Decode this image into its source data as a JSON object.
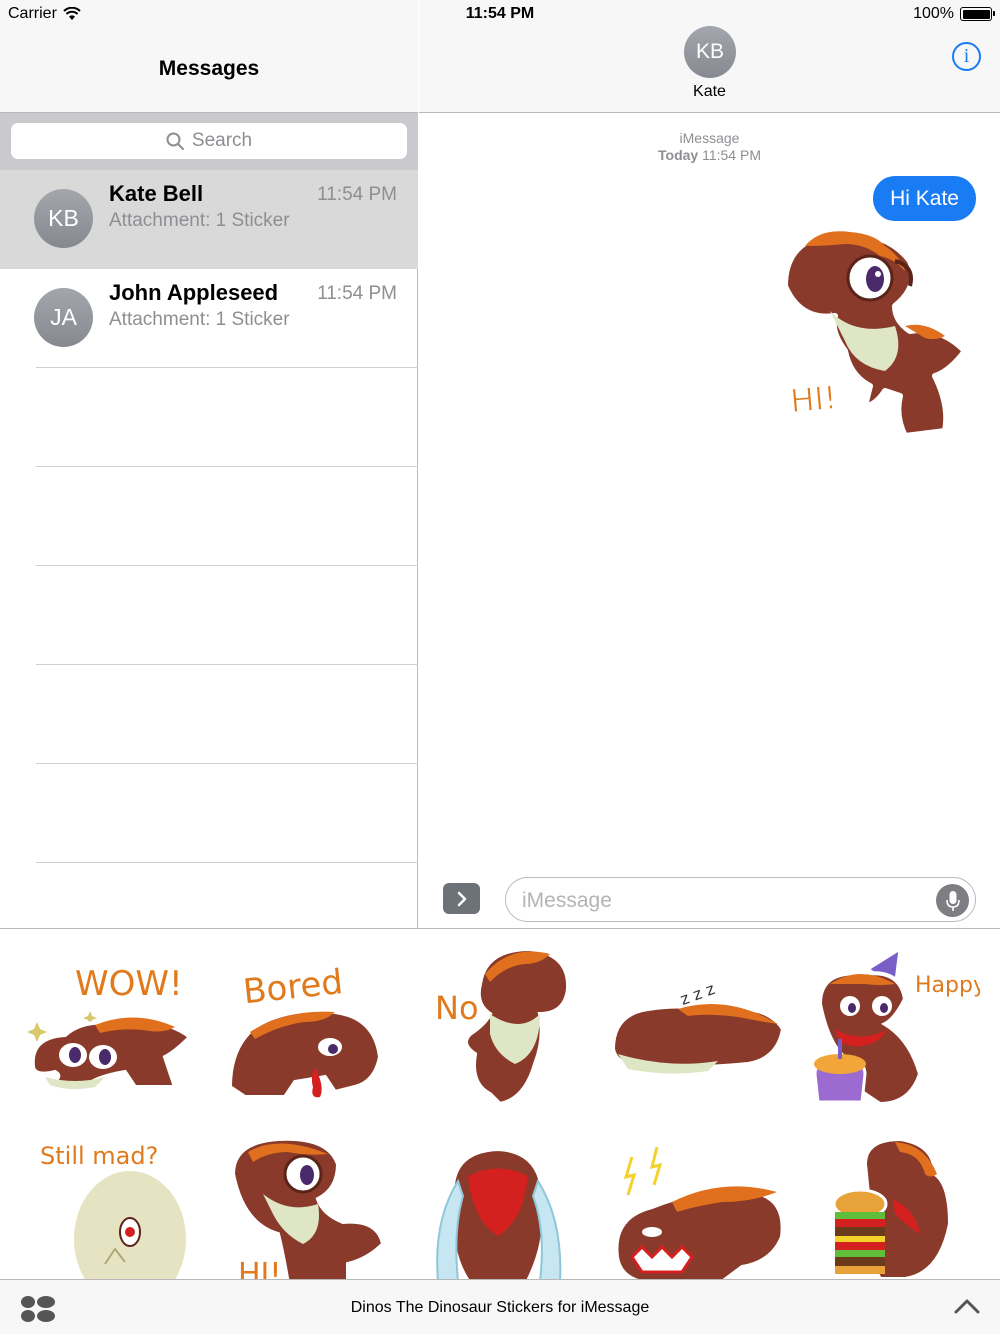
{
  "status_bar": {
    "carrier": "Carrier",
    "time": "11:54 PM",
    "battery": "100%"
  },
  "sidebar": {
    "title": "Messages",
    "search_placeholder": "Search",
    "conversations": [
      {
        "initials": "KB",
        "name": "Kate Bell",
        "preview": "Attachment: 1 Sticker",
        "time": "11:54 PM",
        "selected": true
      },
      {
        "initials": "JA",
        "name": "John Appleseed",
        "preview": "Attachment: 1 Sticker",
        "time": "11:54 PM",
        "selected": false
      }
    ]
  },
  "chat": {
    "contact_initials": "KB",
    "contact_name": "Kate",
    "service": "iMessage",
    "timestamp_day": "Today",
    "timestamp_time": "11:54 PM",
    "messages": [
      {
        "type": "text",
        "from": "me",
        "text": "Hi Kate"
      },
      {
        "type": "sticker",
        "from": "me",
        "sticker_text": "HI!"
      }
    ],
    "compose_placeholder": "iMessage"
  },
  "sticker_drawer": {
    "stickers": [
      {
        "id": "wow",
        "text": "WOW!"
      },
      {
        "id": "bored",
        "text": "Bored"
      },
      {
        "id": "no",
        "text": "No"
      },
      {
        "id": "sleep",
        "text": "z z z"
      },
      {
        "id": "bday",
        "text": "Happy B-Day"
      },
      {
        "id": "stillmad",
        "text": "Still mad?"
      },
      {
        "id": "hi",
        "text": "HI!"
      },
      {
        "id": "cry",
        "text": ""
      },
      {
        "id": "angry",
        "text": ""
      },
      {
        "id": "burger",
        "text": ""
      }
    ],
    "app_title": "Dinos The Dinosaur Stickers for iMessage"
  },
  "colors": {
    "accent": "#1a7cf5",
    "dino_body": "#8a3a2a",
    "dino_spikes": "#e0701e",
    "sticker_text": "#e07a1c"
  }
}
